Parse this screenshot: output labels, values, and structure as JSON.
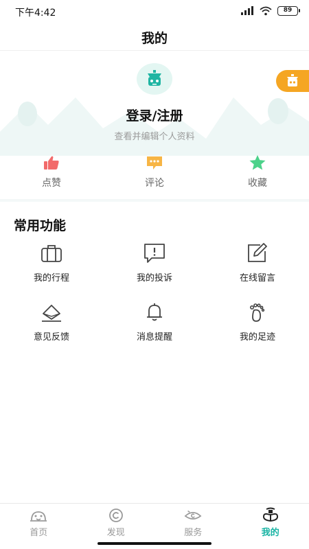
{
  "status_bar": {
    "time": "下午4:42",
    "battery": "89"
  },
  "header": {
    "title": "我的"
  },
  "profile": {
    "login_label": "登录/注册",
    "subtitle": "查看并编辑个人资料",
    "stats": [
      {
        "label": "点赞",
        "icon": "thumbs-up-icon",
        "color": "#f26b6b"
      },
      {
        "label": "评论",
        "icon": "comment-icon",
        "color": "#f7b545"
      },
      {
        "label": "收藏",
        "icon": "star-icon",
        "color": "#4cd28a"
      }
    ]
  },
  "functions": {
    "title": "常用功能",
    "items": [
      {
        "label": "我的行程",
        "icon": "suitcase-icon"
      },
      {
        "label": "我的投诉",
        "icon": "complaint-icon"
      },
      {
        "label": "在线留言",
        "icon": "edit-icon"
      },
      {
        "label": "意见反馈",
        "icon": "feedback-icon"
      },
      {
        "label": "消息提醒",
        "icon": "bell-icon"
      },
      {
        "label": "我的足迹",
        "icon": "footprint-icon"
      }
    ]
  },
  "bottom_nav": {
    "items": [
      {
        "label": "首页",
        "icon": "home-icon",
        "active": false
      },
      {
        "label": "发现",
        "icon": "discover-icon",
        "active": false
      },
      {
        "label": "服务",
        "icon": "service-icon",
        "active": false
      },
      {
        "label": "我的",
        "icon": "profile-icon",
        "active": true
      }
    ]
  },
  "colors": {
    "accent": "#17b3a3",
    "badge": "#f5a623"
  }
}
